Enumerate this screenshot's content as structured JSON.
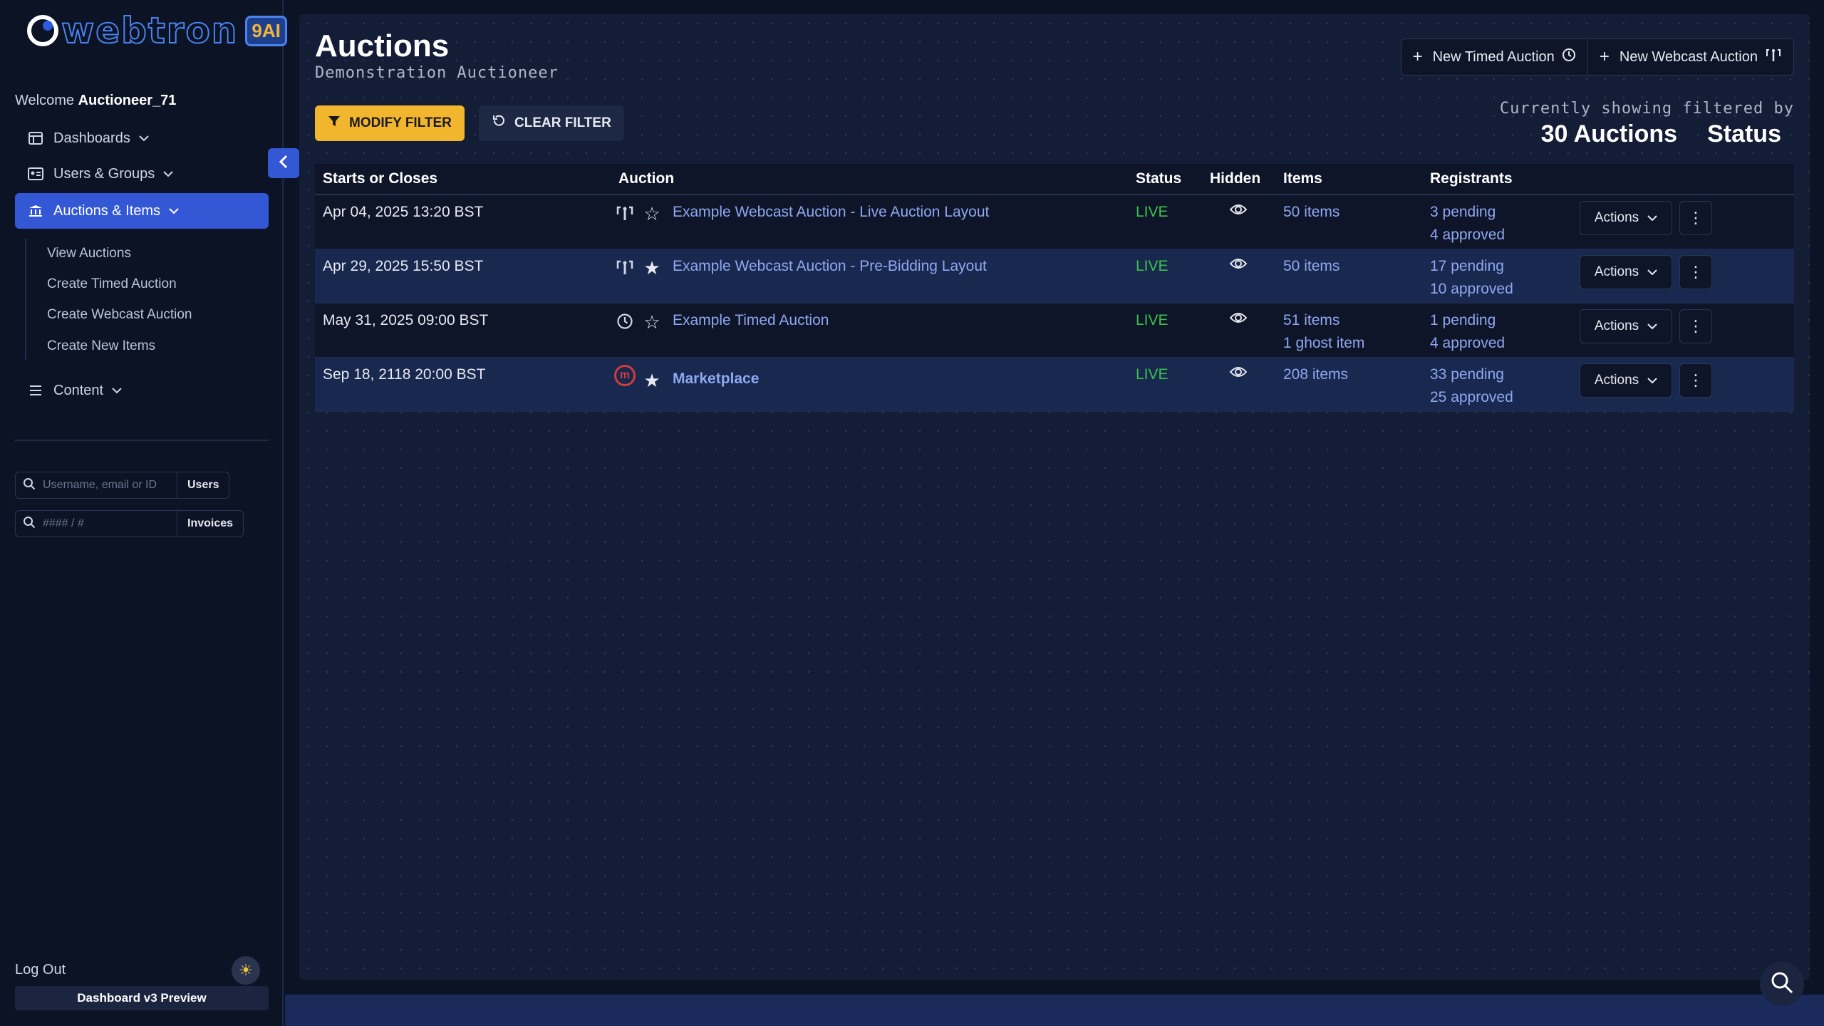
{
  "brand": {
    "name": "webtron",
    "badge": "9AI"
  },
  "welcome": {
    "prefix": "Welcome",
    "username": "Auctioneer_71"
  },
  "nav": {
    "dashboards": "Dashboards",
    "users_groups": "Users & Groups",
    "auctions_items": "Auctions & Items",
    "sub": [
      "View Auctions",
      "Create Timed Auction",
      "Create Webcast Auction",
      "Create New Items"
    ],
    "content": "Content"
  },
  "search": {
    "users_placeholder": "Username, email or ID",
    "users_button": "Users",
    "invoices_placeholder": "#### / #",
    "invoices_button": "Invoices"
  },
  "footer": {
    "logout": "Log Out",
    "preview": "Dashboard v3 Preview"
  },
  "page": {
    "title": "Auctions",
    "subtitle": "Demonstration Auctioneer"
  },
  "top_actions": {
    "new_timed": "New Timed Auction",
    "new_webcast": "New Webcast Auction"
  },
  "filters": {
    "modify": "MODIFY FILTER",
    "clear": "CLEAR FILTER",
    "showing_label": "Currently showing filtered by",
    "count": "30 Auctions",
    "field": "Status"
  },
  "table": {
    "headers": [
      "Starts or Closes",
      "Auction",
      "Status",
      "Hidden",
      "Items",
      "Registrants"
    ],
    "rows": [
      {
        "date": "Apr 04, 2025 13:20 BST",
        "type": "webcast",
        "starred": false,
        "name": "Example Webcast Auction - Live Auction Layout",
        "status": "LIVE",
        "items": "50 items",
        "items2": "",
        "pending": "3 pending",
        "approved": "4 approved",
        "actions": "Actions"
      },
      {
        "date": "Apr 29, 2025 15:50 BST",
        "type": "webcast",
        "starred": true,
        "name": "Example Webcast Auction - Pre-Bidding Layout",
        "status": "LIVE",
        "items": "50 items",
        "items2": "",
        "pending": "17 pending",
        "approved": "10 approved",
        "actions": "Actions"
      },
      {
        "date": "May 31, 2025 09:00 BST",
        "type": "timed",
        "starred": false,
        "name": "Example Timed Auction",
        "status": "LIVE",
        "items": "51 items",
        "items2": "1 ghost item",
        "pending": "1 pending",
        "approved": "4 approved",
        "actions": "Actions"
      },
      {
        "date": "Sep 18, 2118 20:00 BST",
        "type": "marketplace",
        "starred": true,
        "name": "Marketplace",
        "status": "LIVE",
        "items": "208 items",
        "items2": "",
        "pending": "33 pending",
        "approved": "25 approved",
        "actions": "Actions"
      }
    ]
  },
  "colors": {
    "accent": "#3457d5",
    "filter": "#f2b62e",
    "live": "#3ac24a",
    "link": "#8fa7f0"
  }
}
